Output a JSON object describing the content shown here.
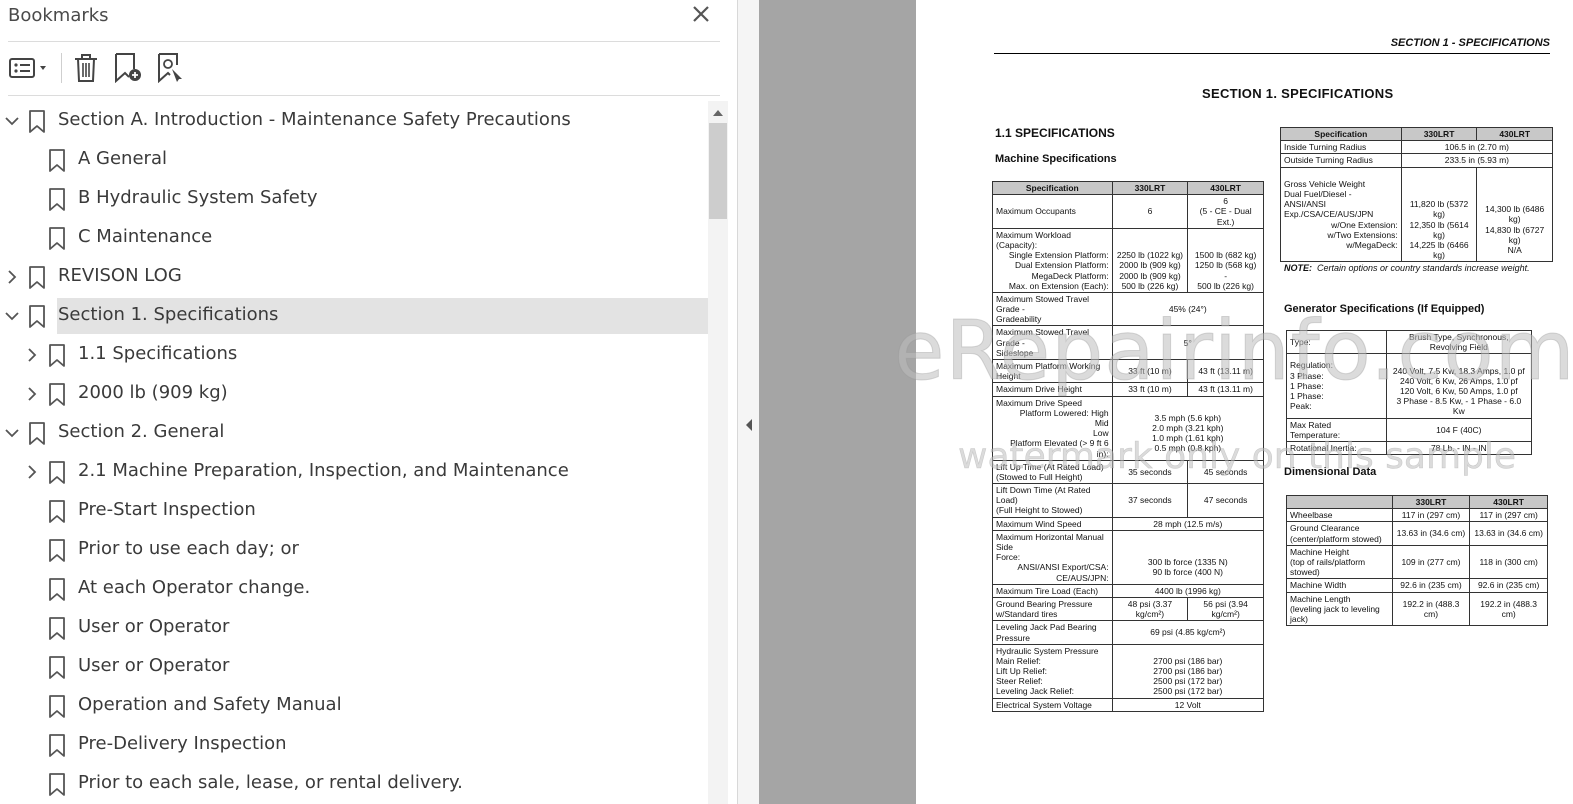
{
  "panel": {
    "title": "Bookmarks",
    "toolbar": {
      "options_icon": "list-options-icon",
      "delete_icon": "trash-icon",
      "new_bookmark_icon": "bookmark-add-icon",
      "find_bookmark_icon": "bookmark-find-icon"
    }
  },
  "bookmarks": [
    {
      "label": "Section A. Introduction - Maintenance Safety Precautions",
      "level": 0,
      "toggle": "expanded"
    },
    {
      "label": "A General",
      "level": 1,
      "toggle": "none"
    },
    {
      "label": "B Hydraulic System Safety",
      "level": 1,
      "toggle": "none"
    },
    {
      "label": "C Maintenance",
      "level": 1,
      "toggle": "none"
    },
    {
      "label": "REVISON LOG",
      "level": 0,
      "toggle": "collapsed"
    },
    {
      "label": "Section 1. Specifications",
      "level": 0,
      "toggle": "expanded",
      "selected": true
    },
    {
      "label": "1.1 Specifications",
      "level": 1,
      "toggle": "collapsed"
    },
    {
      "label": "2000 lb (909 kg)",
      "level": 1,
      "toggle": "collapsed"
    },
    {
      "label": "Section 2. General",
      "level": 0,
      "toggle": "expanded"
    },
    {
      "label": "2.1 Machine Preparation, Inspection, and Maintenance",
      "level": 1,
      "toggle": "collapsed"
    },
    {
      "label": "Pre-Start Inspection",
      "level": 1,
      "toggle": "none"
    },
    {
      "label": "Prior to use each day; or",
      "level": 1,
      "toggle": "none"
    },
    {
      "label": "At each Operator change.",
      "level": 1,
      "toggle": "none"
    },
    {
      "label": "User or Operator",
      "level": 1,
      "toggle": "none"
    },
    {
      "label": "User or Operator",
      "level": 1,
      "toggle": "none"
    },
    {
      "label": "Operation and Safety Manual",
      "level": 1,
      "toggle": "none"
    },
    {
      "label": "Pre-Delivery Inspection",
      "level": 1,
      "toggle": "none"
    },
    {
      "label": "Prior to each sale, lease, or rental delivery.",
      "level": 1,
      "toggle": "none"
    }
  ],
  "document": {
    "running_head": "SECTION 1 - SPECIFICATIONS",
    "section_title": "SECTION 1.  SPECIFICATIONS",
    "subsection": "1.1     SPECIFICATIONS",
    "machine_specs_title": "Machine Specifications",
    "headers": [
      "Specification",
      "330LRT",
      "430LRT"
    ],
    "machine_specs": {
      "occupants": {
        "label": "Maximum Occupants",
        "a": "6",
        "b": "6",
        "b2": "(5 - CE - Dual Ext.)"
      },
      "workload": {
        "label1": "Maximum Workload",
        "label2": "(Capacity):",
        "rows": [
          {
            "label": "Single Extension Platform:",
            "a": "2250 lb (1022 kg)",
            "b": "1500 lb (682 kg)"
          },
          {
            "label": "Dual Extension Platform:",
            "a": "2000 lb (909 kg)",
            "b": "1250 lb (568 kg)"
          },
          {
            "label": "MegaDeck Platform:",
            "a": "2000 lb (909 kg)",
            "b": "-"
          },
          {
            "label": "Max. on Extension (Each):",
            "a": "500 lb (226 kg)",
            "b": "500 lb (226 kg)"
          }
        ]
      },
      "gradeability": {
        "label1": "Maximum Stowed Travel Grade -",
        "label2": "Gradeability",
        "v": "45% (24°)"
      },
      "sideslope": {
        "label1": "Maximum Stowed Travel Grade -",
        "label2": "Sideslope",
        "v": "5°"
      },
      "working_height": {
        "label1": "Maximum Platform Working",
        "label2": "Height",
        "a": "33 ft (10 m)",
        "b": "43 ft (13.11 m)"
      },
      "drive_height": {
        "label": "Maximum Drive Height",
        "a": "33 ft (10 m)",
        "b": "43 ft (13.11 m)"
      },
      "drive_speed": {
        "label": "Maximum Drive Speed",
        "rows": [
          {
            "label": "Platform Lowered: High",
            "v": "3.5 mph (5.6 kph)"
          },
          {
            "label": "Mid",
            "v": "2.0 mph (3.21 kph)"
          },
          {
            "label": "Low",
            "v": "1.0 mph (1.61 kph)"
          },
          {
            "label": "Platform Elevated (> 9 ft 6 in):",
            "v": "0.5 mph (0.8 kph)"
          }
        ]
      },
      "lift_up": {
        "label1": "Lift Up Time (At Rated Load)",
        "label2": "(Stowed to Full Height)",
        "a": "35 seconds",
        "b": "45 seconds"
      },
      "lift_down": {
        "label1": "Lift Down Time (At Rated Load)",
        "label2": "(Full Height to Stowed)",
        "a": "37 seconds",
        "b": "47 seconds"
      },
      "wind": {
        "label": "Maximum Wind Speed",
        "v": "28 mph (12.5 m/s)"
      },
      "side_force": {
        "label1": "Maximum Horizontal Manual Side",
        "label2": "Force:",
        "rows": [
          {
            "label": "ANSI/ANSI Export/CSA:",
            "v": "300 lb force (1335 N)"
          },
          {
            "label": "CE/AUS/JPN:",
            "v": "90 lb force (400 N)"
          }
        ]
      },
      "tire_load": {
        "label": "Maximum Tire Load (Each)",
        "v": "4400 lb (1996 kg)"
      },
      "ground_pressure": {
        "label1": "Ground Bearing Pressure",
        "label2": "w/Standard tires",
        "a": "48 psi (3.37 kg/cm²)",
        "b": "56 psi (3.94 kg/cm²)"
      },
      "jack_pad": {
        "label1": "Leveling Jack Pad Bearing",
        "label2": "Pressure",
        "v": "69 psi (4.85 kg/cm²)"
      },
      "hydraulic": {
        "label": "Hydraulic System Pressure",
        "rows": [
          {
            "label": "Main Relief:",
            "v": "2700 psi (186 bar)"
          },
          {
            "label": "Lift Up Relief:",
            "v": "2700 psi (186 bar)"
          },
          {
            "label": "Steer Relief:",
            "v": "2500 psi (172 bar)"
          },
          {
            "label": "Leveling Jack Relief:",
            "v": "2500 psi (172 bar)"
          }
        ]
      },
      "voltage": {
        "label": "Electrical System Voltage",
        "v": "12 Volt"
      }
    },
    "turning": {
      "inside": {
        "label": "Inside Turning Radius",
        "v": "106.5 in (2.70 m)"
      },
      "outside": {
        "label": "Outside Turning Radius",
        "v": "233.5 in (5.93 m)"
      },
      "gvw": {
        "label1": "Gross Vehicle Weight",
        "label2": "Dual Fuel/Diesel -",
        "label3": "ANSI/ANSI Exp./CSA/CE/AUS/JPN",
        "rows": [
          {
            "label": "w/One Extension:",
            "a": "11,820 lb (5372 kg)",
            "b": "14,300 lb (6486 kg)"
          },
          {
            "label": "w/Two Extensions:",
            "a": "12,350 lb (5614 kg)",
            "b": "14,830 lb (6727 kg)"
          },
          {
            "label": "w/MegaDeck:",
            "a": "14,225 lb (6466 kg)",
            "b": "N/A"
          }
        ]
      }
    },
    "note_label": "NOTE:",
    "note_text": "Certain options or country standards increase weight.",
    "generator_title": "Generator Specifications (If Equipped)",
    "generator": {
      "type": {
        "label": "Type:",
        "v": "Brush Type, Synchronous, Revolving Field"
      },
      "regulation": {
        "rows": [
          {
            "label": "Regulation:",
            "v": ""
          },
          {
            "label": "3 Phase:",
            "v": "240 Volt, 7.5 Kw, 18.3 Amps, 1.0 pf"
          },
          {
            "label": "1 Phase:",
            "v": "240 Volt, 6 Kw, 26 Amps, 1.0 pf"
          },
          {
            "label": "1 Phase:",
            "v": "120 Volt, 6 Kw, 50 Amps, 1.0 pf"
          },
          {
            "label": "Peak:",
            "v": "3 Phase - 8.5 Kw, - 1 Phase - 6.0 Kw"
          }
        ]
      },
      "max_temp": {
        "label": "Max Rated Temperature:",
        "v": "104 F (40C)"
      },
      "inertia": {
        "label": "Rotational Inertia:",
        "v": "78 Lb. - IN - IN"
      }
    },
    "dimensional_title": "Dimensional Data",
    "dimensional_headers": [
      "",
      "330LRT",
      "430LRT"
    ],
    "dimensional": [
      {
        "label1": "Wheelbase",
        "label2": "",
        "a": "117 in (297 cm)",
        "b": "117 in (297 cm)"
      },
      {
        "label1": "Ground Clearance",
        "label2": "(center/platform stowed)",
        "a": "13.63 in (34.6 cm)",
        "b": "13.63 in (34.6 cm)"
      },
      {
        "label1": "Machine Height",
        "label2": "(top of rails/platform stowed)",
        "a": "109 in (277 cm)",
        "b": "118 in (300 cm)"
      },
      {
        "label1": "Machine Width",
        "label2": "",
        "a": "92.6 in (235 cm)",
        "b": "92.6 in (235 cm)"
      },
      {
        "label1": "Machine Length",
        "label2": "(leveling jack to leveling jack)",
        "a": "192.2 in (488.3 cm)",
        "b": "192.2 in (488.3 cm)"
      }
    ]
  },
  "watermark": {
    "line1": "eRepairinfo.com",
    "line2": "watermark only on this sample"
  }
}
